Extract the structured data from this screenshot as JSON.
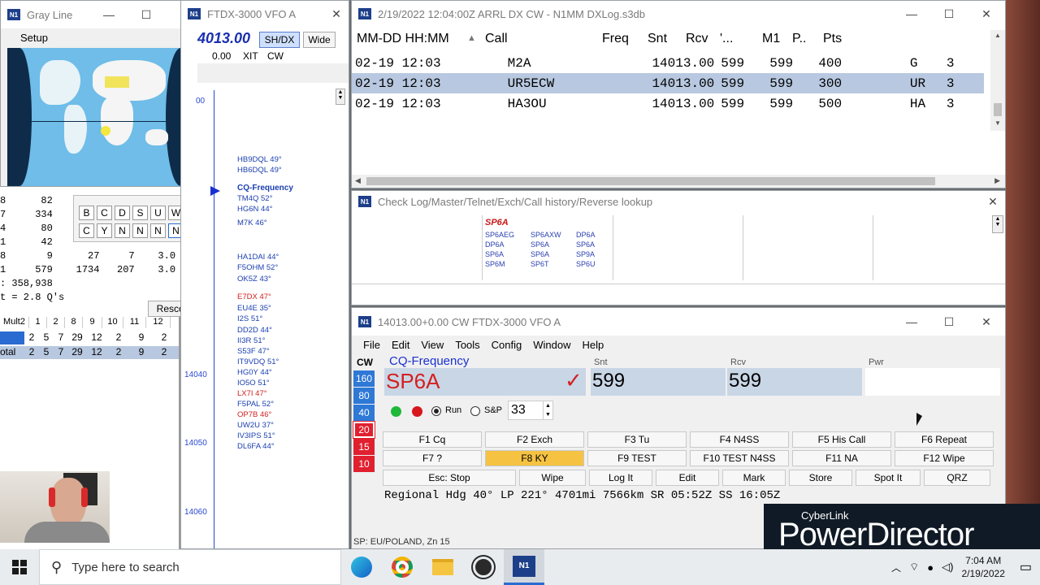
{
  "gray_line": {
    "title": "Gray Line",
    "setup_label": "Setup"
  },
  "stats_panel": {
    "rows": [
      "8      82",
      "7     334",
      "4      80",
      "1      42",
      "8       9      27     7    3.0",
      "1     579    1734   207    3.0"
    ],
    "score": ": 358,938",
    "rate": "t = 2.8 Q's",
    "rescore_label": "Rescore",
    "mult_header": [
      "Mult2",
      "1",
      "2",
      "8",
      "9",
      "10",
      "11",
      "12"
    ],
    "mult_row1": [
      "",
      "2",
      "5",
      "7",
      "29",
      "12",
      "2",
      "9",
      "2"
    ],
    "mult_total_label": "otal",
    "mult_row2": [
      "2",
      "5",
      "7",
      "29",
      "12",
      "2",
      "9",
      "2"
    ],
    "keypad": [
      [
        "B",
        "C",
        "D",
        "S",
        "U",
        "W"
      ],
      [
        "C",
        "Y",
        "N",
        "N",
        "N",
        "N"
      ]
    ]
  },
  "bandmap": {
    "title": "FTDX-3000 VFO A",
    "freq": "4013.00",
    "shdx_label": "SH/DX",
    "wide_label": "Wide",
    "rit": "0.00",
    "xit_label": "XIT",
    "mode": "CW",
    "scale_labels": [
      "00",
      "14040",
      "14050",
      "14060"
    ],
    "calls": [
      {
        "call": "HB9DQL 49°",
        "color": "#1a3fb0"
      },
      {
        "call": "HB6DQL 49°",
        "color": "#1a3fb0"
      },
      {
        "call": "CQ-Frequency",
        "color": "#1a3fb0"
      },
      {
        "call": "TM4Q 52°",
        "color": "#1a3fb0"
      },
      {
        "call": "HG6N 44°",
        "color": "#1a3fb0"
      },
      {
        "call": "M7K 46°",
        "color": "#1a3fb0"
      },
      {
        "call": "HA1DAI 44°",
        "color": "#1a3fb0"
      },
      {
        "call": "F5OHM 52°",
        "color": "#1a3fb0"
      },
      {
        "call": "OK5Z 43°",
        "color": "#1a3fb0"
      },
      {
        "call": "E7DX 47°",
        "color": "#d42020"
      },
      {
        "call": "EU4E 35°",
        "color": "#1a3fb0"
      },
      {
        "call": "I2S 51°",
        "color": "#1a3fb0"
      },
      {
        "call": "DD2D 44°",
        "color": "#1a3fb0"
      },
      {
        "call": "II3R 51°",
        "color": "#1a3fb0"
      },
      {
        "call": "S53F 47°",
        "color": "#1a3fb0"
      },
      {
        "call": "IT9VDQ 51°",
        "color": "#1a3fb0"
      },
      {
        "call": "HG0Y 44°",
        "color": "#1a3fb0"
      },
      {
        "call": "IO5O 51°",
        "color": "#1a3fb0"
      },
      {
        "call": "LX7I 47°",
        "color": "#d42020"
      },
      {
        "call": "F5PAL 52°",
        "color": "#1a3fb0"
      },
      {
        "call": "OP7B 46°",
        "color": "#d42020"
      },
      {
        "call": "UW2U 37°",
        "color": "#1a3fb0"
      },
      {
        "call": "IV3IPS 51°",
        "color": "#1a3fb0"
      },
      {
        "call": "DL6FA 44°",
        "color": "#1a3fb0"
      }
    ]
  },
  "log_window": {
    "title": "2/19/2022 12:04:00Z  ARRL DX CW - N1MM DXLog.s3db",
    "columns": [
      "MM-DD HH:MM",
      "▲",
      "Call",
      "Freq",
      "Snt",
      "Rcv",
      "'...",
      "M1",
      "P..",
      "Pts"
    ],
    "rows": [
      [
        "02-19 12:03",
        "M2A",
        "14013.00",
        "599",
        "599",
        "400",
        "",
        "G",
        "3"
      ],
      [
        "02-19 12:03",
        "UR5ECW",
        "14013.00",
        "599",
        "599",
        "300",
        "",
        "UR",
        "3"
      ],
      [
        "02-19 12:03",
        "HA3OU",
        "14013.00",
        "599",
        "599",
        "500",
        "",
        "HA",
        "3"
      ]
    ]
  },
  "check_window": {
    "title": "Check Log/Master/Telnet/Exch/Call history/Reverse lookup",
    "partial_label": "SP6A",
    "col1": [
      "SP6AEG",
      "DP6A",
      "SP6A",
      "SP6M"
    ],
    "col2": [
      "SP6AXW",
      "SP6A",
      "SP6A",
      "SP6T"
    ],
    "col3": [
      "DP6A",
      "SP6A",
      "SP9A",
      "SP6U"
    ]
  },
  "entry_window": {
    "title": "14013.00+0.00 CW FTDX-3000 VFO A",
    "menu": [
      "File",
      "Edit",
      "View",
      "Tools",
      "Config",
      "Window",
      "Help"
    ],
    "mode_label": "CW",
    "bands": [
      "160",
      "80",
      "40",
      "20",
      "15",
      "10"
    ],
    "cq_label": "CQ-Frequency",
    "call_value": "SP6A",
    "snt_label": "Snt",
    "snt_value": "599",
    "rcv_label": "Rcv",
    "rcv_value": "599",
    "pwr_label": "Pwr",
    "run_label": "Run",
    "sp_label": "S&P",
    "serial": "33",
    "fkeys_row1": [
      "F1 Cq",
      "F2 Exch",
      "F3 Tu",
      "F4 N4SS",
      "F5 His Call",
      "F6 Repeat"
    ],
    "fkeys_row2": [
      "F7 ?",
      "F8 KY",
      "F9 TEST",
      "F10 TEST N4SS",
      "F11 NA",
      "F12 Wipe"
    ],
    "buttons": [
      "Esc: Stop",
      "Wipe",
      "Log It",
      "Edit",
      "Mark",
      "Store",
      "Spot It",
      "QRZ"
    ],
    "info_line": "Regional Hdg 40° LP 221° 4701mi 7566km SR 05:52Z SS 16:05Z",
    "status_line": "SP: EU/POLAND, Zn 15"
  },
  "watermark": {
    "small": "CyberLink",
    "big": "PowerDirector"
  },
  "taskbar": {
    "search_placeholder": "Type here to search",
    "time": "7:04 AM",
    "date": "2/19/2022"
  },
  "colors": {
    "accent_blue": "#1d3f8a",
    "selection": "#b8c8e0",
    "band_blue": "#2e78d6",
    "band_red": "#e0202f",
    "highlight_key": "#f5c242"
  }
}
